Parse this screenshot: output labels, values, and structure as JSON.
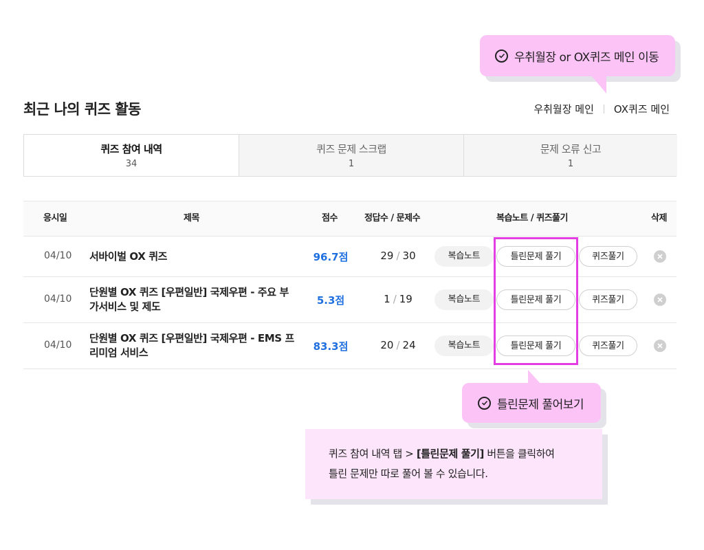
{
  "tooltip_top": {
    "text": "우취월장 or OX퀴즈 메인 이동"
  },
  "page_title": "최근 나의 퀴즈 활동",
  "top_links": [
    "우취월장 메인",
    "OX퀴즈 메인"
  ],
  "tabs": [
    {
      "label": "퀴즈 참여 내역",
      "count": "34",
      "active": true
    },
    {
      "label": "퀴즈 문제 스크랩",
      "count": "1",
      "active": false
    },
    {
      "label": "문제 오류 신고",
      "count": "1",
      "active": false
    }
  ],
  "table": {
    "headers": {
      "date": "응시일",
      "title": "제목",
      "score": "점수",
      "count": "정답수 / 문제수",
      "review": "복습노트 / 퀴즈풀기",
      "delete": "삭제"
    },
    "rows": [
      {
        "date": "04/10",
        "title": "서바이벌 OX 퀴즈",
        "score": "96.7점",
        "correct": "29",
        "total": "30"
      },
      {
        "date": "04/10",
        "title": "단원별 OX 퀴즈 [우편일반] 국제우편 - 주요 부가서비스 및 제도",
        "score": "5.3점",
        "correct": "1",
        "total": "19"
      },
      {
        "date": "04/10",
        "title": "단원별 OX 퀴즈 [우편일반] 국제우편 - EMS 프리미엄 서비스",
        "score": "83.3점",
        "correct": "20",
        "total": "24"
      }
    ],
    "buttons": {
      "note": "복습노트",
      "wrong": "틀린문제 풀기",
      "solve": "퀴즈풀기",
      "separator": "/"
    }
  },
  "tooltip_bottom": {
    "text": "틀린문제 풀어보기"
  },
  "note": {
    "line1_pre": "퀴즈 참여 내역 탭 > ",
    "line1_bold": "[틀린문제 풀기]",
    "line1_post": " 버튼을 클릭하여",
    "line2": "틀린 문제만 따로 풀어 볼 수 있습니다."
  },
  "colors": {
    "accent": "#1f6fe0",
    "tooltip_bg": "#fcc3f7",
    "highlight": "#e33ee2",
    "note_bg": "#fde5fb"
  },
  "icons": {
    "check": "check-circle-icon",
    "delete": "close-circle-icon"
  }
}
